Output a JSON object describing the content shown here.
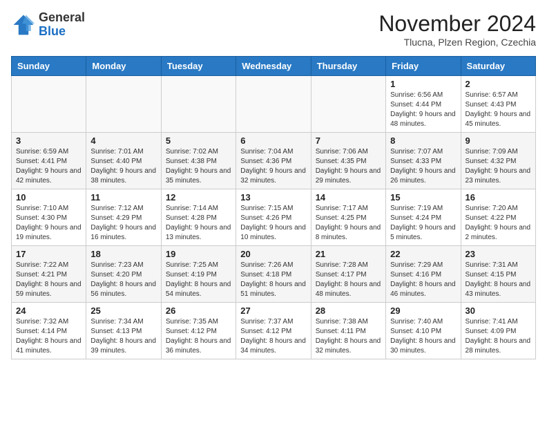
{
  "logo": {
    "general": "General",
    "blue": "Blue"
  },
  "title": "November 2024",
  "subtitle": "Tlucna, Plzen Region, Czechia",
  "days_of_week": [
    "Sunday",
    "Monday",
    "Tuesday",
    "Wednesday",
    "Thursday",
    "Friday",
    "Saturday"
  ],
  "weeks": [
    [
      {
        "day": "",
        "info": ""
      },
      {
        "day": "",
        "info": ""
      },
      {
        "day": "",
        "info": ""
      },
      {
        "day": "",
        "info": ""
      },
      {
        "day": "",
        "info": ""
      },
      {
        "day": "1",
        "info": "Sunrise: 6:56 AM\nSunset: 4:44 PM\nDaylight: 9 hours and 48 minutes."
      },
      {
        "day": "2",
        "info": "Sunrise: 6:57 AM\nSunset: 4:43 PM\nDaylight: 9 hours and 45 minutes."
      }
    ],
    [
      {
        "day": "3",
        "info": "Sunrise: 6:59 AM\nSunset: 4:41 PM\nDaylight: 9 hours and 42 minutes."
      },
      {
        "day": "4",
        "info": "Sunrise: 7:01 AM\nSunset: 4:40 PM\nDaylight: 9 hours and 38 minutes."
      },
      {
        "day": "5",
        "info": "Sunrise: 7:02 AM\nSunset: 4:38 PM\nDaylight: 9 hours and 35 minutes."
      },
      {
        "day": "6",
        "info": "Sunrise: 7:04 AM\nSunset: 4:36 PM\nDaylight: 9 hours and 32 minutes."
      },
      {
        "day": "7",
        "info": "Sunrise: 7:06 AM\nSunset: 4:35 PM\nDaylight: 9 hours and 29 minutes."
      },
      {
        "day": "8",
        "info": "Sunrise: 7:07 AM\nSunset: 4:33 PM\nDaylight: 9 hours and 26 minutes."
      },
      {
        "day": "9",
        "info": "Sunrise: 7:09 AM\nSunset: 4:32 PM\nDaylight: 9 hours and 23 minutes."
      }
    ],
    [
      {
        "day": "10",
        "info": "Sunrise: 7:10 AM\nSunset: 4:30 PM\nDaylight: 9 hours and 19 minutes."
      },
      {
        "day": "11",
        "info": "Sunrise: 7:12 AM\nSunset: 4:29 PM\nDaylight: 9 hours and 16 minutes."
      },
      {
        "day": "12",
        "info": "Sunrise: 7:14 AM\nSunset: 4:28 PM\nDaylight: 9 hours and 13 minutes."
      },
      {
        "day": "13",
        "info": "Sunrise: 7:15 AM\nSunset: 4:26 PM\nDaylight: 9 hours and 10 minutes."
      },
      {
        "day": "14",
        "info": "Sunrise: 7:17 AM\nSunset: 4:25 PM\nDaylight: 9 hours and 8 minutes."
      },
      {
        "day": "15",
        "info": "Sunrise: 7:19 AM\nSunset: 4:24 PM\nDaylight: 9 hours and 5 minutes."
      },
      {
        "day": "16",
        "info": "Sunrise: 7:20 AM\nSunset: 4:22 PM\nDaylight: 9 hours and 2 minutes."
      }
    ],
    [
      {
        "day": "17",
        "info": "Sunrise: 7:22 AM\nSunset: 4:21 PM\nDaylight: 8 hours and 59 minutes."
      },
      {
        "day": "18",
        "info": "Sunrise: 7:23 AM\nSunset: 4:20 PM\nDaylight: 8 hours and 56 minutes."
      },
      {
        "day": "19",
        "info": "Sunrise: 7:25 AM\nSunset: 4:19 PM\nDaylight: 8 hours and 54 minutes."
      },
      {
        "day": "20",
        "info": "Sunrise: 7:26 AM\nSunset: 4:18 PM\nDaylight: 8 hours and 51 minutes."
      },
      {
        "day": "21",
        "info": "Sunrise: 7:28 AM\nSunset: 4:17 PM\nDaylight: 8 hours and 48 minutes."
      },
      {
        "day": "22",
        "info": "Sunrise: 7:29 AM\nSunset: 4:16 PM\nDaylight: 8 hours and 46 minutes."
      },
      {
        "day": "23",
        "info": "Sunrise: 7:31 AM\nSunset: 4:15 PM\nDaylight: 8 hours and 43 minutes."
      }
    ],
    [
      {
        "day": "24",
        "info": "Sunrise: 7:32 AM\nSunset: 4:14 PM\nDaylight: 8 hours and 41 minutes."
      },
      {
        "day": "25",
        "info": "Sunrise: 7:34 AM\nSunset: 4:13 PM\nDaylight: 8 hours and 39 minutes."
      },
      {
        "day": "26",
        "info": "Sunrise: 7:35 AM\nSunset: 4:12 PM\nDaylight: 8 hours and 36 minutes."
      },
      {
        "day": "27",
        "info": "Sunrise: 7:37 AM\nSunset: 4:12 PM\nDaylight: 8 hours and 34 minutes."
      },
      {
        "day": "28",
        "info": "Sunrise: 7:38 AM\nSunset: 4:11 PM\nDaylight: 8 hours and 32 minutes."
      },
      {
        "day": "29",
        "info": "Sunrise: 7:40 AM\nSunset: 4:10 PM\nDaylight: 8 hours and 30 minutes."
      },
      {
        "day": "30",
        "info": "Sunrise: 7:41 AM\nSunset: 4:09 PM\nDaylight: 8 hours and 28 minutes."
      }
    ]
  ]
}
